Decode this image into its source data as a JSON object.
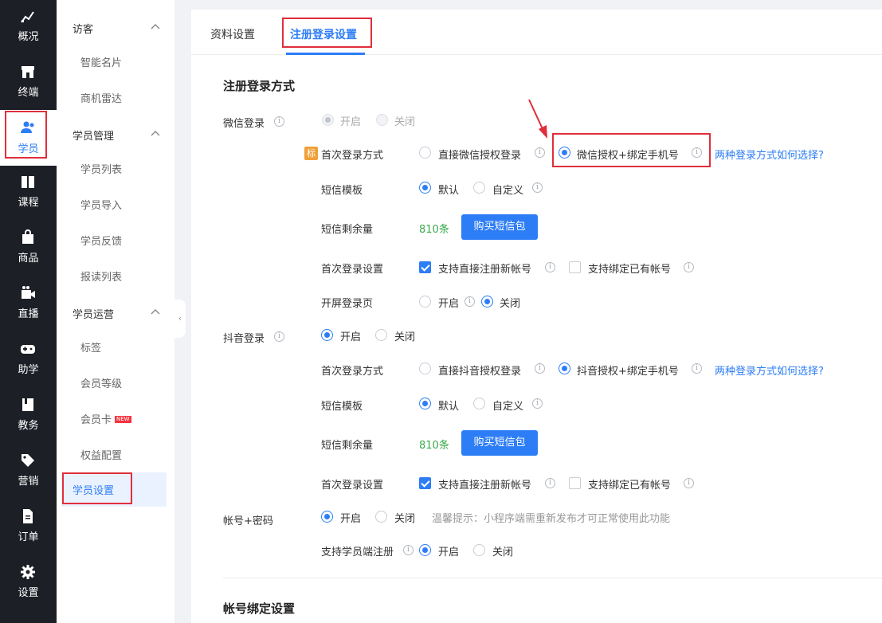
{
  "rail": {
    "items": [
      "概况",
      "终端",
      "学员",
      "课程",
      "商品",
      "直播",
      "助学",
      "教务",
      "营销",
      "订单",
      "设置"
    ]
  },
  "nav": {
    "groups": [
      "访客",
      "学员管理",
      "学员运营"
    ],
    "visitor": [
      "智能名片",
      "商机雷达"
    ],
    "student": [
      "学员列表",
      "学员导入",
      "学员反馈",
      "报读列表"
    ],
    "ops": [
      "标签",
      "会员等级",
      "会员卡",
      "权益配置",
      "学员设置"
    ],
    "new_badge": "NEW"
  },
  "tabs": [
    "资料设置",
    "注册登录设置"
  ],
  "section1": "注册登录方式",
  "section2": "帐号绑定设置",
  "wechat": {
    "label": "微信登录",
    "on": "开启",
    "off": "关闭",
    "tag": "标",
    "first_login_label": "首次登录方式",
    "opt_direct": "直接微信授权登录",
    "opt_bind": "微信授权+绑定手机号",
    "help": "两种登录方式如何选择?",
    "sms_tpl_label": "短信模板",
    "sms_default": "默认",
    "sms_custom": "自定义",
    "sms_left_label": "短信剩余量",
    "sms_left": "810条",
    "buy": "购买短信包",
    "first_setting_label": "首次登录设置",
    "reg_new": "支持直接注册新帐号",
    "bind_old": "支持绑定已有帐号",
    "splash_label": "开屏登录页",
    "splash_on": "开启",
    "splash_off": "关闭"
  },
  "douyin": {
    "label": "抖音登录",
    "on": "开启",
    "off": "关闭",
    "first_login_label": "首次登录方式",
    "opt_direct": "直接抖音授权登录",
    "opt_bind": "抖音授权+绑定手机号",
    "help": "两种登录方式如何选择?",
    "sms_tpl_label": "短信模板",
    "sms_default": "默认",
    "sms_custom": "自定义",
    "sms_left_label": "短信剩余量",
    "sms_left": "810条",
    "buy": "购买短信包",
    "first_setting_label": "首次登录设置",
    "reg_new": "支持直接注册新帐号",
    "bind_old": "支持绑定已有帐号"
  },
  "account": {
    "label": "帐号+密码",
    "on": "开启",
    "off": "关闭",
    "tip": "温馨提示：小程序端需重新发布才可正常使用此功能",
    "reg_label": "支持学员端注册",
    "reg_on": "开启",
    "reg_off": "关闭"
  },
  "colors": {
    "accent": "#2d7df6",
    "highlight": "#e02e3b",
    "green": "#39a94c",
    "rail": "#1d1f26"
  }
}
